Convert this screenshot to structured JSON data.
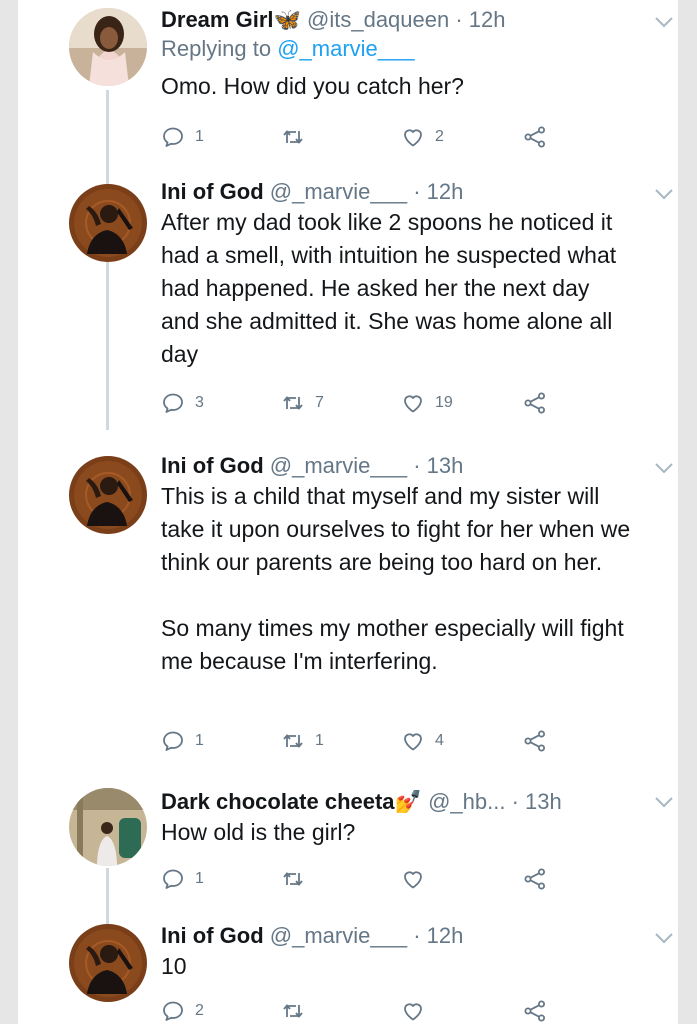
{
  "tweets": [
    {
      "name": "Dream Girl🦋",
      "handle": "@its_daqueen",
      "time": "· 12h",
      "replying_label": "Replying to",
      "replying_to": "@_marvie___",
      "text": "Omo. How did you catch her?",
      "replies": "1",
      "retweets": "",
      "likes": "2"
    },
    {
      "name": "Ini of God",
      "handle": "@_marvie___",
      "time": "· 12h",
      "text": "After my dad took like 2 spoons he noticed it had a smell, with intuition he suspected what had happened. He asked her the next day and she admitted it. She was home alone all day",
      "replies": "3",
      "retweets": "7",
      "likes": "19"
    },
    {
      "name": "Ini of God",
      "handle": "@_marvie___",
      "time": "· 13h",
      "text": "This is a child that myself and my sister will take it upon ourselves to fight for her when we think our parents are being too hard on her.\n\nSo many times my mother especially will fight me because I'm interfering.",
      "replies": "1",
      "retweets": "1",
      "likes": "4"
    },
    {
      "name": "Dark chocolate cheeta💅",
      "handle": "@_hb...",
      "time": "· 13h",
      "text": "How old is the girl?",
      "replies": "1",
      "retweets": "",
      "likes": ""
    },
    {
      "name": "Ini of God",
      "handle": "@_marvie___",
      "time": "· 12h",
      "text": "10",
      "replies": "2",
      "retweets": "",
      "likes": ""
    }
  ],
  "icons": {
    "reply": "reply-icon",
    "retweet": "retweet-icon",
    "like": "heart-icon",
    "share": "share-icon",
    "more": "chevron-down-icon"
  },
  "colors": {
    "text": "#14171a",
    "muted": "#657786",
    "link": "#1da1f2",
    "thread_line": "#cfd9de"
  }
}
